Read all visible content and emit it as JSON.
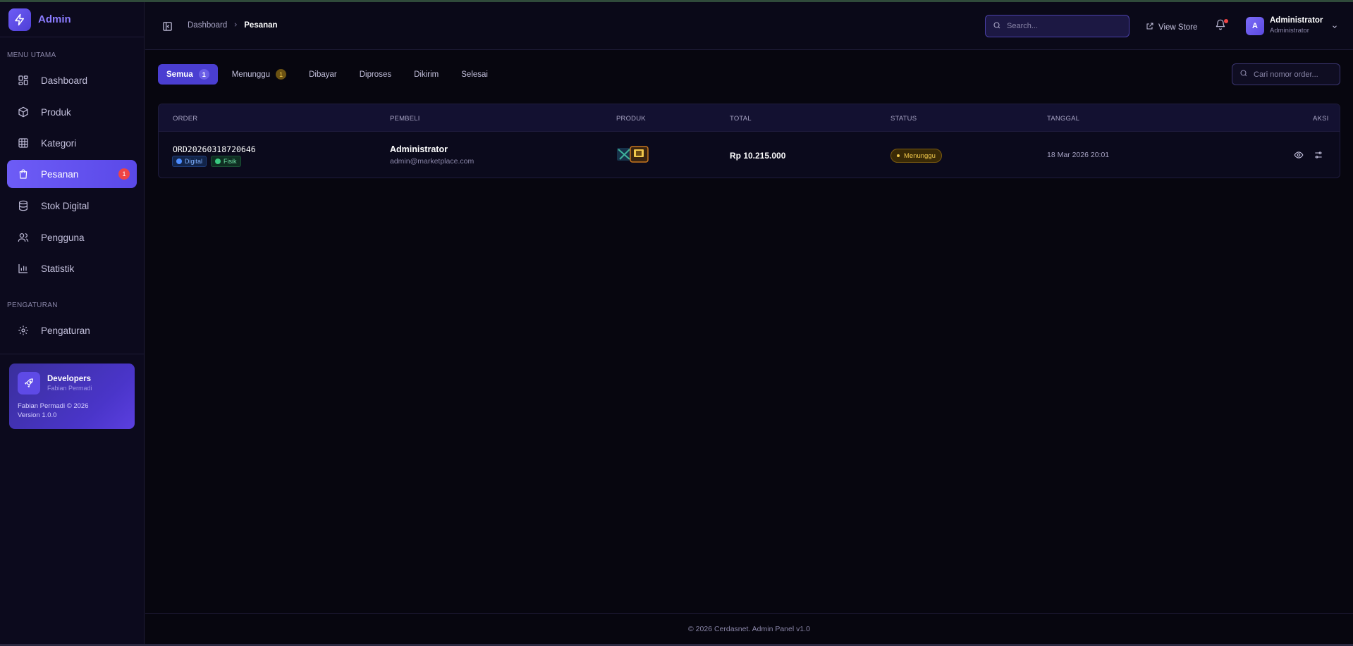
{
  "brand": {
    "name": "Admin"
  },
  "sidebar": {
    "section_main": "MENU UTAMA",
    "items": [
      {
        "label": "Dashboard",
        "icon": "dashboard-icon"
      },
      {
        "label": "Produk",
        "icon": "box-icon"
      },
      {
        "label": "Kategori",
        "icon": "grid-icon"
      },
      {
        "label": "Pesanan",
        "icon": "bag-icon",
        "badge": "1",
        "active": true
      },
      {
        "label": "Stok Digital",
        "icon": "database-icon"
      },
      {
        "label": "Pengguna",
        "icon": "users-icon"
      },
      {
        "label": "Statistik",
        "icon": "chart-icon"
      }
    ],
    "section_settings": "PENGATURAN",
    "settings_item": {
      "label": "Pengaturan",
      "icon": "gear-icon"
    },
    "dev_card": {
      "title": "Developers",
      "subtitle": "Fabian Permadi",
      "copyright": "Fabian Permadi © 2026",
      "version": "Version 1.0.0"
    }
  },
  "header": {
    "breadcrumb": {
      "parent": "Dashboard",
      "current": "Pesanan"
    },
    "search_placeholder": "Search...",
    "view_store": "View Store",
    "user": {
      "avatar": "A",
      "name": "Administrator",
      "role": "Administrator"
    }
  },
  "tabs": [
    {
      "label": "Semua",
      "count": "1",
      "active": true
    },
    {
      "label": "Menunggu",
      "count": "1"
    },
    {
      "label": "Dibayar"
    },
    {
      "label": "Diproses"
    },
    {
      "label": "Dikirim"
    },
    {
      "label": "Selesai"
    }
  ],
  "order_search_placeholder": "Cari nomor order...",
  "table": {
    "columns": [
      "ORDER",
      "PEMBELI",
      "PRODUK",
      "TOTAL",
      "STATUS",
      "TANGGAL",
      "AKSI"
    ],
    "rows": [
      {
        "order_id": "ORD20260318720646",
        "tags": [
          "Digital",
          "Fisik"
        ],
        "buyer_name": "Administrator",
        "buyer_email": "admin@marketplace.com",
        "total": "Rp 10.215.000",
        "status": "Menunggu",
        "date": "18 Mar 2026 20:01"
      }
    ]
  },
  "footer": {
    "text": "© 2026 Cerdasnet. Admin Panel v1.0"
  },
  "colors": {
    "accent": "#6d5cf6",
    "background": "#07060f",
    "sidebar": "#0c0a1d",
    "status_pending": "#f2c94c",
    "badge_red": "#ef4444"
  }
}
